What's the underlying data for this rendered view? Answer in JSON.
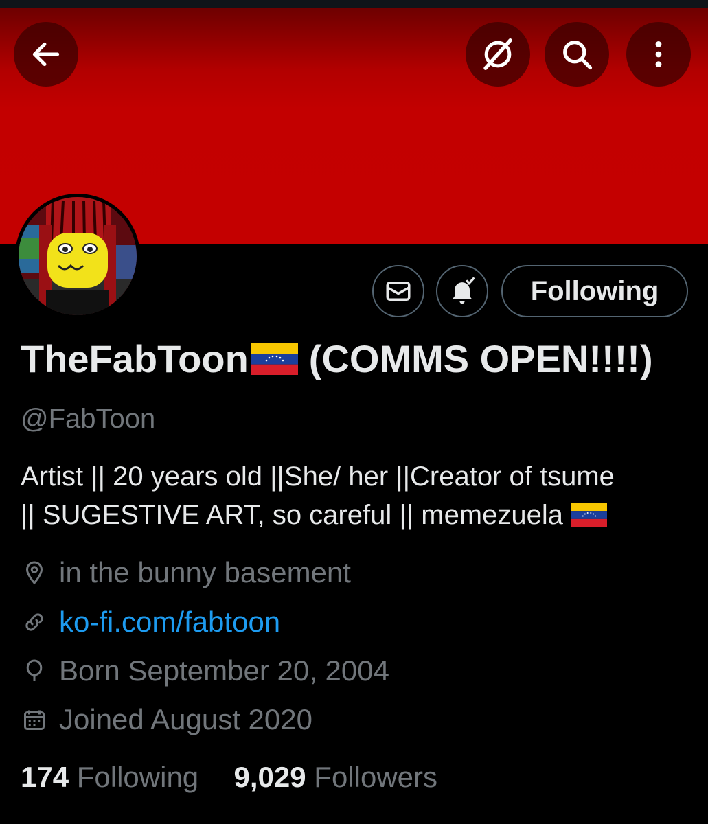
{
  "header": {
    "back_icon": "arrow-left-icon",
    "grok_icon": "grok-icon",
    "search_icon": "search-icon",
    "more_icon": "more-vertical-icon"
  },
  "banner": {
    "color": "#c40000"
  },
  "actions": {
    "message_icon": "envelope-icon",
    "notify_icon": "bell-check-icon",
    "follow_label": "Following"
  },
  "profile": {
    "display_name_before": "TheFabToon",
    "display_name_after": "(COMMS OPEN!!!!)",
    "flag_icon": "venezuela-flag-icon",
    "handle": "@FabToon",
    "bio_line1": "Artist || 20 years old ||She/ her ||Creator of tsume",
    "bio_line2": "|| SUGESTIVE ART, so careful || memezuela",
    "location": "in the bunny basement",
    "website": "ko-fi.com/fabtoon",
    "birthday": "Born September 20, 2004",
    "joined": "Joined August 2020"
  },
  "stats": {
    "following_count": "174",
    "following_label": "Following",
    "followers_count": "9,029",
    "followers_label": "Followers"
  },
  "colors": {
    "accent_link": "#1d9bf0",
    "secondary_text": "#71767b",
    "primary_text": "#e7e9ea"
  }
}
